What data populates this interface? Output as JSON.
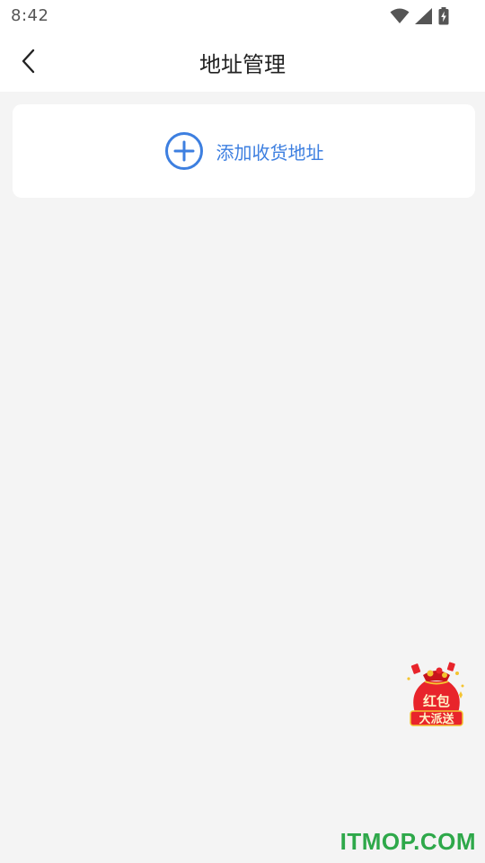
{
  "theme": {
    "accent": "#3d7fe0",
    "background": "#f4f4f4",
    "watermark_color": "#2ea84a",
    "promo_red": "#e8242b"
  },
  "status_bar": {
    "time": "8:42",
    "icons": [
      "wifi-icon",
      "signal-icon",
      "battery-charging-icon"
    ]
  },
  "header": {
    "back_icon": "chevron-left-icon",
    "title": "地址管理"
  },
  "add_address": {
    "icon": "plus-circle-icon",
    "label": "添加收货地址"
  },
  "floating_promo": {
    "icon": "red-envelope-icon",
    "line1": "红包",
    "line2": "大派送"
  },
  "watermark": {
    "text": "ITMOP.COM"
  }
}
